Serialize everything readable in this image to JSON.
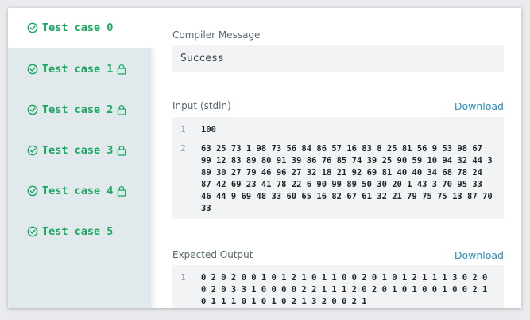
{
  "tabs": [
    {
      "label": "Test case 0",
      "locked": false,
      "active": true
    },
    {
      "label": "Test case 1",
      "locked": true,
      "active": false
    },
    {
      "label": "Test case 2",
      "locked": true,
      "active": false
    },
    {
      "label": "Test case 3",
      "locked": true,
      "active": false
    },
    {
      "label": "Test case 4",
      "locked": true,
      "active": false
    },
    {
      "label": "Test case 5",
      "locked": false,
      "active": false
    }
  ],
  "compiler": {
    "title": "Compiler Message",
    "message": "Success"
  },
  "input": {
    "title": "Input (stdin)",
    "download_label": "Download",
    "line1_no": "1",
    "line1": "100",
    "line2_no": "2",
    "line2": "63 25 73 1 98 73 56 84 86 57 16 83 8 25 81 56 9 53 98 67 99 12 83 89 80 91 39 86 76 85 74 39 25 90 59 10 94 32 44 3 89 30 27 79 46 96 27 32 18 21 92 69 81 40 40 34 68 78 24 87 42 69 23 41 78 22 6 90 99 89 50 30 20 1 43 3 70 95 33 46 44 9 69 48 33 60 65 16 82 67 61 32 21 79 75 75 13 87 70 33"
  },
  "expected": {
    "title": "Expected Output",
    "download_label": "Download",
    "line1_no": "1",
    "line1": "0 2 0 2 0 0 1 0 1 2 1 0 1 1 0 0 2 0 1 0 1 2 1 1 1 3 0 2 0 0 2 0 3 3 1 0 0 0 0 2 2 1 1 1 2 0 2 0 1 0 1 0 0 1 0 0 2 1 0 1 1 1 0 1 0 1 0 2 1 3 2 0 0 2 1"
  },
  "colors": {
    "accent_green": "#1aa861",
    "link_blue": "#2a8fc4",
    "sidebar_bg": "#e1e9ec",
    "code_bg": "#f1f3f4"
  },
  "icons": {
    "tab_status": "check-circle-icon",
    "tab_locked": "lock-icon"
  }
}
